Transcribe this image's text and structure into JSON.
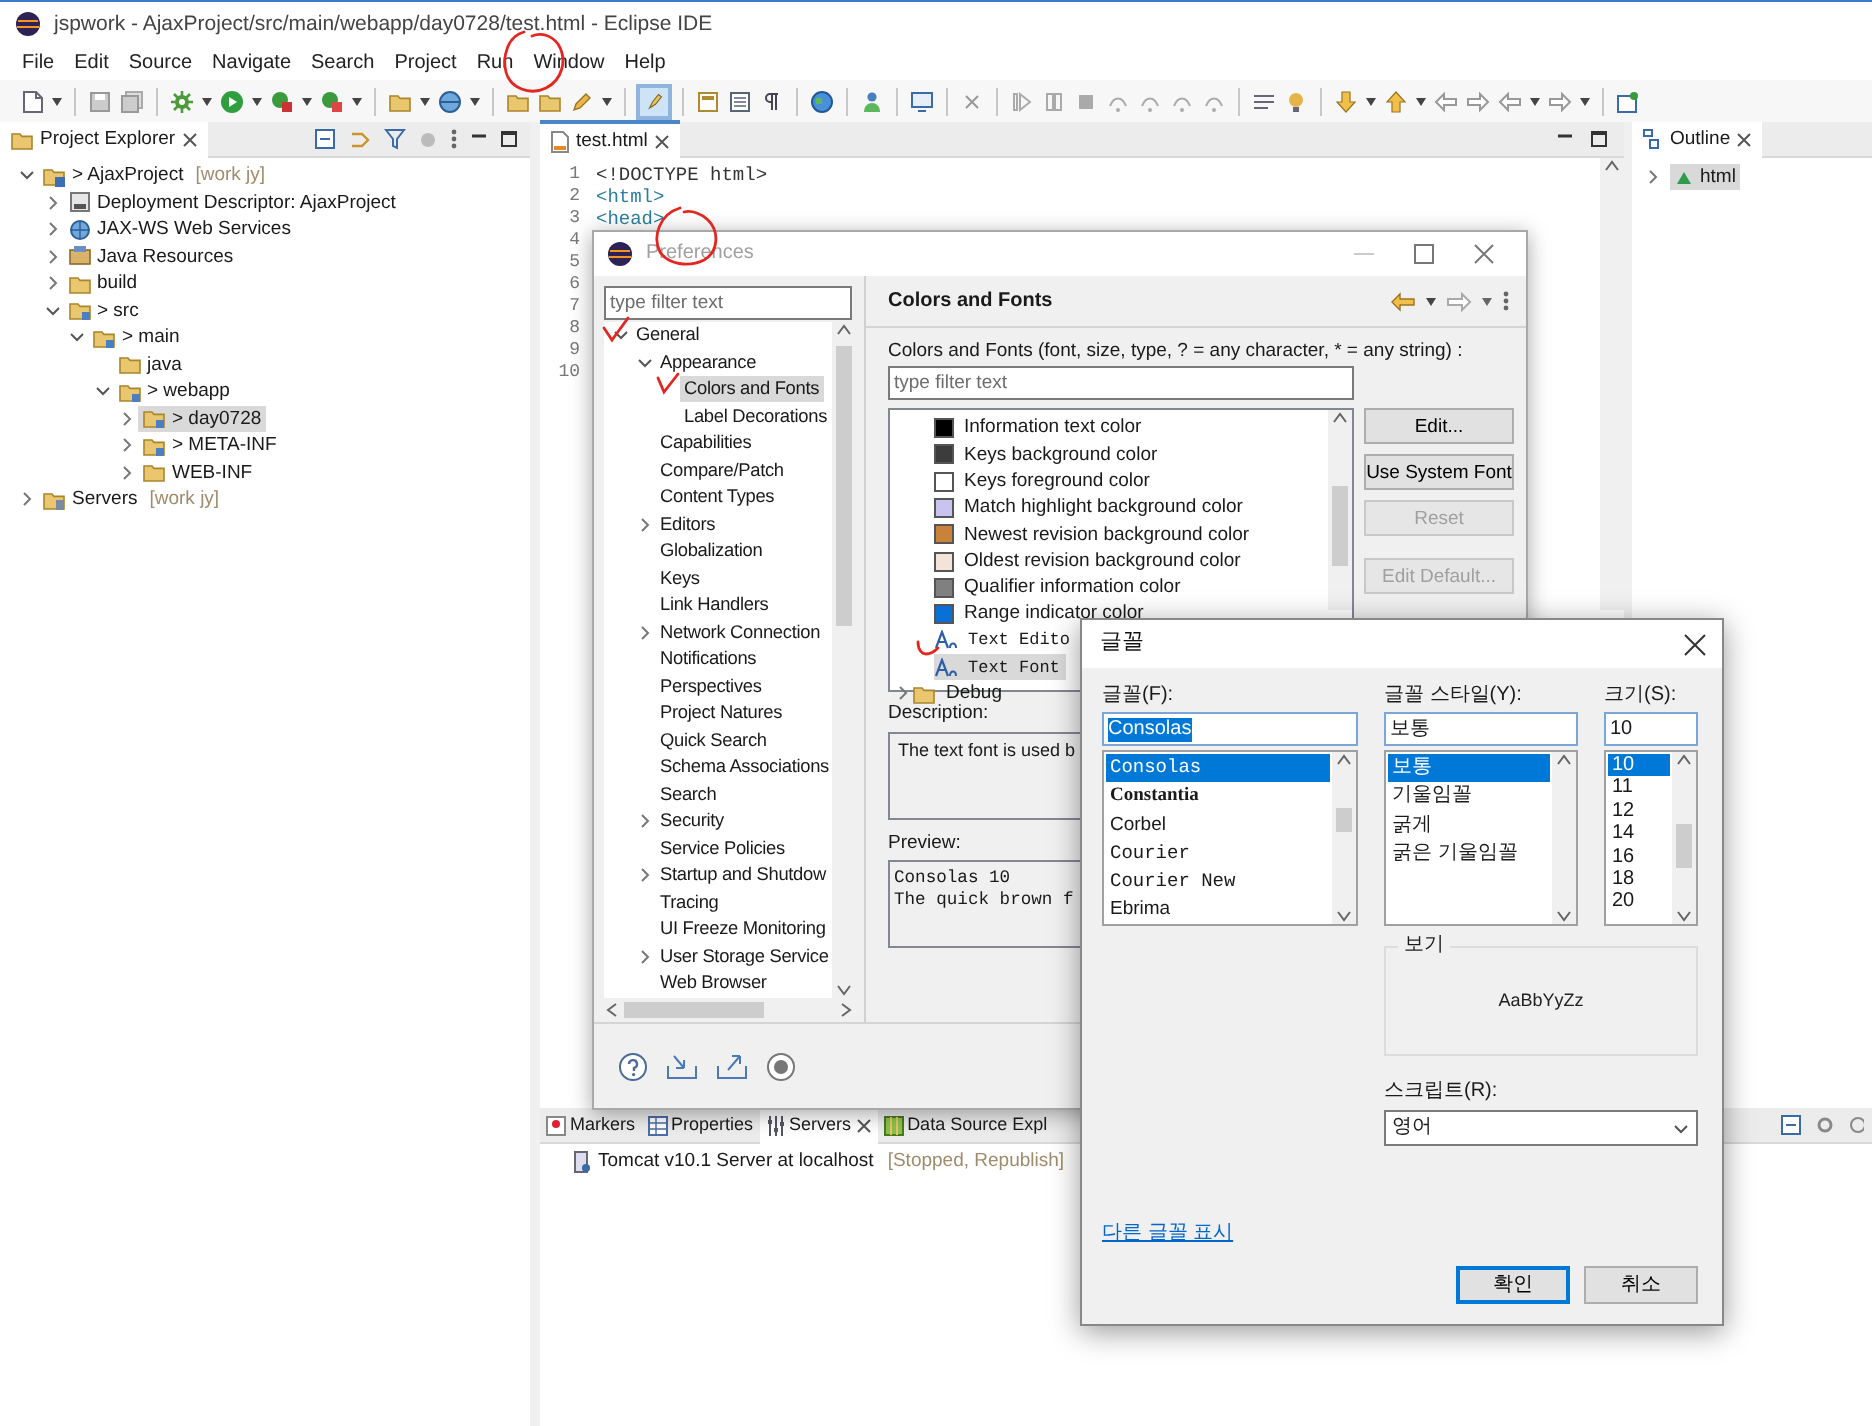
{
  "window": {
    "title": "jspwork - AjaxProject/src/main/webapp/day0728/test.html - Eclipse IDE"
  },
  "menu": [
    "File",
    "Edit",
    "Source",
    "Navigate",
    "Search",
    "Project",
    "Run",
    "Window",
    "Help"
  ],
  "project_explorer": {
    "title": "Project Explorer",
    "tree": [
      {
        "label": "> AjaxProject",
        "decoration": "[work jy]",
        "kind": "project",
        "expanded": true,
        "selected": false,
        "children": [
          {
            "label": "Deployment Descriptor: AjaxProject",
            "kind": "descriptor",
            "expanded": false,
            "selected": false
          },
          {
            "label": "JAX-WS Web Services",
            "kind": "webservice",
            "expanded": false,
            "selected": false
          },
          {
            "label": "Java Resources",
            "kind": "library",
            "expanded": false,
            "selected": false
          },
          {
            "label": "build",
            "kind": "folder",
            "expanded": false,
            "selected": false
          },
          {
            "label": "> src",
            "kind": "package",
            "expanded": true,
            "selected": false,
            "children": [
              {
                "label": "> main",
                "kind": "package",
                "expanded": true,
                "selected": false,
                "children": [
                  {
                    "label": "java",
                    "kind": "folder",
                    "selected": false
                  },
                  {
                    "label": "> webapp",
                    "kind": "package",
                    "expanded": true,
                    "selected": false,
                    "children": [
                      {
                        "label": "> day0728",
                        "kind": "package",
                        "expanded": false,
                        "selected": true
                      },
                      {
                        "label": "> META-INF",
                        "kind": "package",
                        "expanded": false,
                        "selected": false
                      },
                      {
                        "label": "WEB-INF",
                        "kind": "folder",
                        "expanded": false,
                        "selected": false
                      }
                    ]
                  }
                ]
              }
            ]
          }
        ]
      },
      {
        "label": "Servers",
        "decoration": "[work jy]",
        "kind": "servers",
        "expanded": false,
        "selected": false
      }
    ]
  },
  "editor": {
    "tab": "test.html",
    "line_numbers": [
      "1",
      "2",
      "3",
      "4",
      "5",
      "6",
      "7",
      "8",
      "9",
      "10"
    ],
    "lines": [
      {
        "kind": "doctype",
        "text": "<!DOCTYPE html>"
      },
      {
        "kind": "tag",
        "text": "<html>"
      },
      {
        "kind": "tag",
        "text": "<head>"
      }
    ]
  },
  "outline": {
    "title": "Outline",
    "tree": [
      {
        "label": "html",
        "kind": "element",
        "expanded": false,
        "selected": true
      }
    ]
  },
  "bottom_panel": {
    "tabs": [
      {
        "label": "Markers",
        "kind": "markers",
        "selected": false
      },
      {
        "label": "Properties",
        "kind": "properties",
        "selected": false
      },
      {
        "label": "Servers",
        "kind": "servers",
        "selected": true
      },
      {
        "label": "Data Source Expl",
        "kind": "datasource",
        "selected": false
      }
    ],
    "rows": [
      {
        "label": "Tomcat v10.1 Server at localhost",
        "status": "[Stopped, Republish]"
      }
    ]
  },
  "preferences": {
    "title": "Preferences",
    "active": false,
    "filter": {
      "placeholder": "type filter text"
    },
    "tree": [
      {
        "label": "General",
        "expanded": true,
        "selected": false,
        "children": [
          {
            "label": "Appearance",
            "expanded": true,
            "selected": false,
            "children": [
              {
                "label": "Colors and Fonts",
                "selected": true
              },
              {
                "label": "Label Decorations",
                "selected": false
              }
            ]
          },
          {
            "label": "Capabilities",
            "selected": false
          },
          {
            "label": "Compare/Patch",
            "selected": false
          },
          {
            "label": "Content Types",
            "selected": false
          },
          {
            "label": "Editors",
            "expanded": false,
            "selected": false
          },
          {
            "label": "Globalization",
            "selected": false
          },
          {
            "label": "Keys",
            "selected": false
          },
          {
            "label": "Link Handlers",
            "selected": false
          },
          {
            "label": "Network Connection",
            "expanded": false,
            "selected": false
          },
          {
            "label": "Notifications",
            "selected": false
          },
          {
            "label": "Perspectives",
            "selected": false
          },
          {
            "label": "Project Natures",
            "selected": false
          },
          {
            "label": "Quick Search",
            "selected": false
          },
          {
            "label": "Schema Associations",
            "selected": false
          },
          {
            "label": "Search",
            "selected": false
          },
          {
            "label": "Security",
            "expanded": false,
            "selected": false
          },
          {
            "label": "Service Policies",
            "selected": false
          },
          {
            "label": "Startup and Shutdow",
            "expanded": false,
            "selected": false
          },
          {
            "label": "Tracing",
            "selected": false
          },
          {
            "label": "UI Freeze Monitoring",
            "selected": false
          },
          {
            "label": "User Storage Service",
            "expanded": false,
            "selected": false
          },
          {
            "label": "Web Browser",
            "selected": false
          }
        ]
      }
    ],
    "page": {
      "title": "Colors and Fonts",
      "intro": "Colors and Fonts (font, size, type, ? = any character, * = any string) :",
      "filter": {
        "placeholder": "type filter text"
      },
      "items": [
        {
          "kind": "color",
          "label": "Information text color",
          "color": "#000000",
          "selected": false
        },
        {
          "kind": "color",
          "label": "Keys background color",
          "color": "#3c3c3c",
          "selected": false
        },
        {
          "kind": "color",
          "label": "Keys foreground color",
          "color": "#ffffff",
          "selected": false
        },
        {
          "kind": "color",
          "label": "Match highlight background color",
          "color": "#c8c4f0",
          "selected": false
        },
        {
          "kind": "color",
          "label": "Newest revision background color",
          "color": "#c8823a",
          "selected": false
        },
        {
          "kind": "color",
          "label": "Oldest revision background color",
          "color": "#f2e4d6",
          "selected": false
        },
        {
          "kind": "color",
          "label": "Qualifier information color",
          "color": "#808080",
          "selected": false
        },
        {
          "kind": "color",
          "label": "Range indicator color",
          "color": "#0a6fd6",
          "selected": false
        },
        {
          "kind": "font",
          "label": "Text Edito",
          "selected": false
        },
        {
          "kind": "font",
          "label": "Text Font",
          "selected": true
        },
        {
          "kind": "category",
          "label": "Debug",
          "expanded": false,
          "selected": false
        }
      ],
      "buttons": [
        {
          "label": "Edit...",
          "disabled": false
        },
        {
          "label": "Use System Font",
          "disabled": false
        },
        {
          "label": "Reset",
          "disabled": true
        },
        {
          "label": "Edit Default...",
          "disabled": true
        }
      ],
      "description": {
        "label": "Description:",
        "text": "The text font is used b"
      },
      "preview": {
        "label": "Preview:",
        "lines": [
          "Consolas 10",
          "The quick brown f"
        ]
      }
    }
  },
  "font_dialog": {
    "title": "글꼴",
    "active": true,
    "font": {
      "label": "글꼴(F):",
      "value": "Consolas",
      "text_selected": true,
      "items": [
        {
          "label": "Consolas",
          "kind": "mono",
          "selected": true
        },
        {
          "label": "Constantia",
          "kind": "serif",
          "selected": false
        },
        {
          "label": "Corbel",
          "kind": "sans",
          "selected": false
        },
        {
          "label": "Courier",
          "kind": "mono",
          "selected": false
        },
        {
          "label": "Courier New",
          "kind": "mono",
          "selected": false
        },
        {
          "label": "Ebrima",
          "kind": "sans",
          "selected": false
        }
      ]
    },
    "style": {
      "label": "글꼴 스타일(Y):",
      "value": "보통",
      "items": [
        {
          "label": "보통",
          "selected": true
        },
        {
          "label": "기울임꼴",
          "selected": false
        },
        {
          "label": "굵게",
          "selected": false
        },
        {
          "label": "굵은 기울임꼴",
          "selected": false
        }
      ]
    },
    "size": {
      "label": "크기(S):",
      "value": "10",
      "items": [
        {
          "label": "10",
          "selected": true
        },
        {
          "label": "11",
          "selected": false
        },
        {
          "label": "12",
          "selected": false
        },
        {
          "label": "14",
          "selected": false
        },
        {
          "label": "16",
          "selected": false
        },
        {
          "label": "18",
          "selected": false
        },
        {
          "label": "20",
          "selected": false
        }
      ]
    },
    "sample": {
      "label": "보기",
      "text": "AaBbYyZz"
    },
    "script": {
      "label": "스크립트(R):",
      "value": "영어"
    },
    "link": "다른 글꼴 표시",
    "buttons": [
      {
        "label": "확인",
        "default": true
      },
      {
        "label": "취소",
        "default": false
      }
    ]
  }
}
